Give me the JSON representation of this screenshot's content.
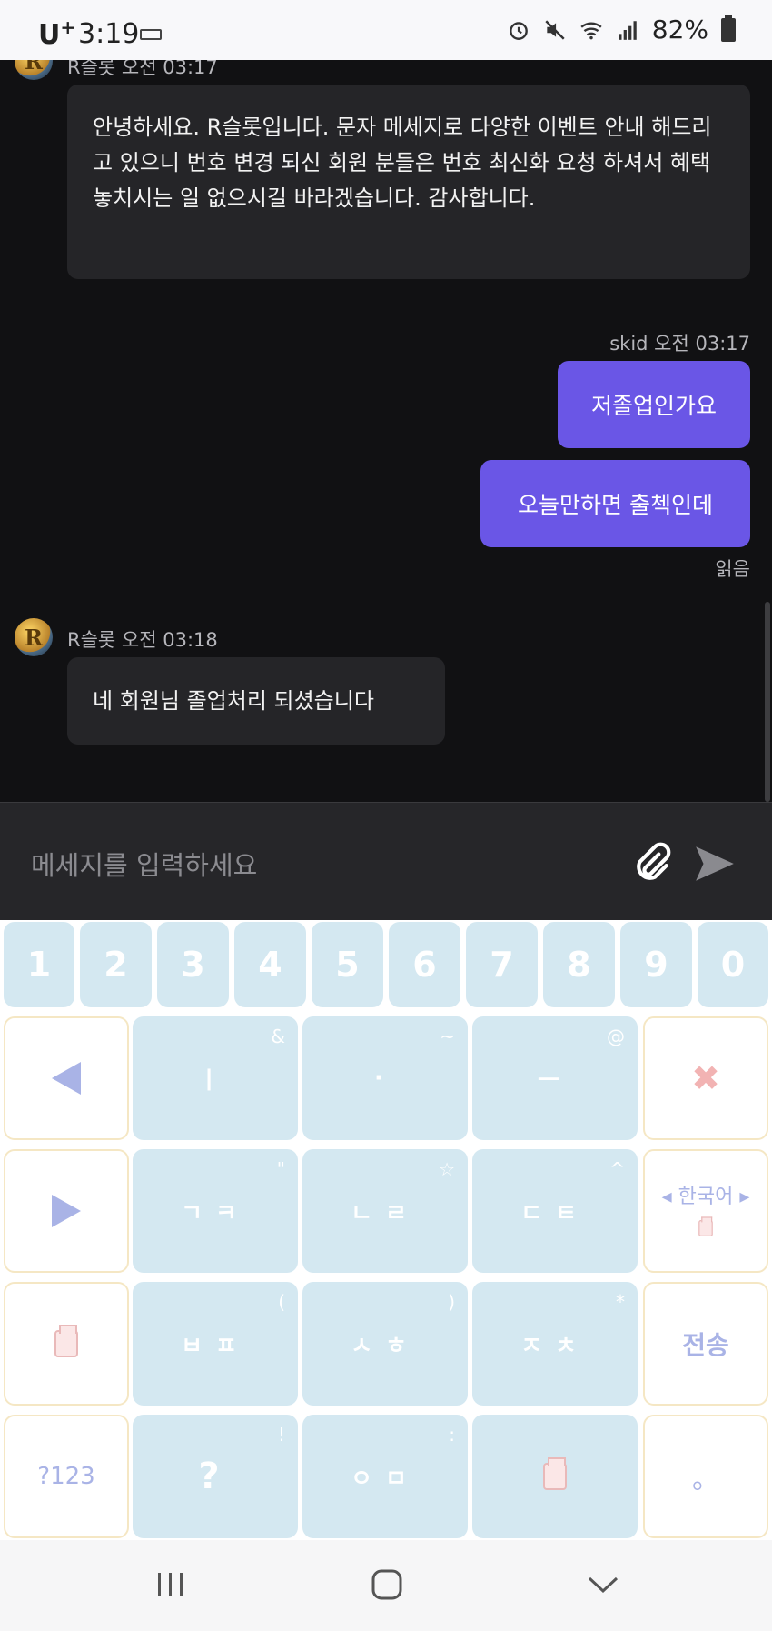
{
  "status_bar": {
    "carrier": "U",
    "carrier_sup": "+",
    "time": "3:19",
    "battery": "82%"
  },
  "chat": {
    "messages": [
      {
        "sender_meta": "R슬롯 오전 03:17",
        "text": "안녕하세요. R슬롯입니다. 문자 메세지로 다양한 이벤트 안내 해드리고 있으니 번호 변경 되신 회원 분들은 번호 최신화 요청 하셔서 혜택 놓치시는 일 없으시길 바라겠습니다. 감사합니다."
      },
      {
        "sender_meta": "skid 오전 03:17",
        "out1": "저졸업인가요",
        "out2": "오늘만하면 출첵인데",
        "read": "읽음"
      },
      {
        "sender_meta": "R슬롯 오전 03:18",
        "text": "네 회원님 졸업처리 되셨습니다"
      }
    ],
    "avatar_letter": "R"
  },
  "input": {
    "placeholder": "메세지를 입력하세요",
    "attach_icon": "paperclip-icon",
    "send_icon": "send-arrow-icon"
  },
  "keyboard": {
    "numbers": [
      "1",
      "2",
      "3",
      "4",
      "5",
      "6",
      "7",
      "8",
      "9",
      "0"
    ],
    "row1": [
      {
        "glyph": "ㅣ",
        "sym": "&"
      },
      {
        "glyph": "·",
        "sym": "~"
      },
      {
        "glyph": "ㅡ",
        "sym": "@"
      }
    ],
    "row2": [
      {
        "glyph": "ㄱㅋ",
        "sym": "\""
      },
      {
        "glyph": "ㄴㄹ",
        "sym": "☆"
      },
      {
        "glyph": "ㄷㅌ",
        "sym": "^"
      }
    ],
    "row3": [
      {
        "glyph": "ㅂㅍ",
        "sym": "("
      },
      {
        "glyph": "ㅅㅎ",
        "sym": ")"
      },
      {
        "glyph": "ㅈㅊ",
        "sym": "*"
      }
    ],
    "row4": [
      {
        "glyph": "?",
        "sym": "!"
      },
      {
        "glyph": "ㅇㅁ",
        "sym": ":"
      }
    ],
    "lang_label": "한국어",
    "send_label": "전송",
    "numsym_label": "?123",
    "period_label": "。",
    "colors": {
      "key": "#d4e8f1",
      "accent": "#a9b3e6",
      "send_bubble": "#6a56e6"
    }
  },
  "nav": {
    "recent": "recents-icon",
    "home": "home-icon",
    "back": "hide-keyboard-icon"
  }
}
